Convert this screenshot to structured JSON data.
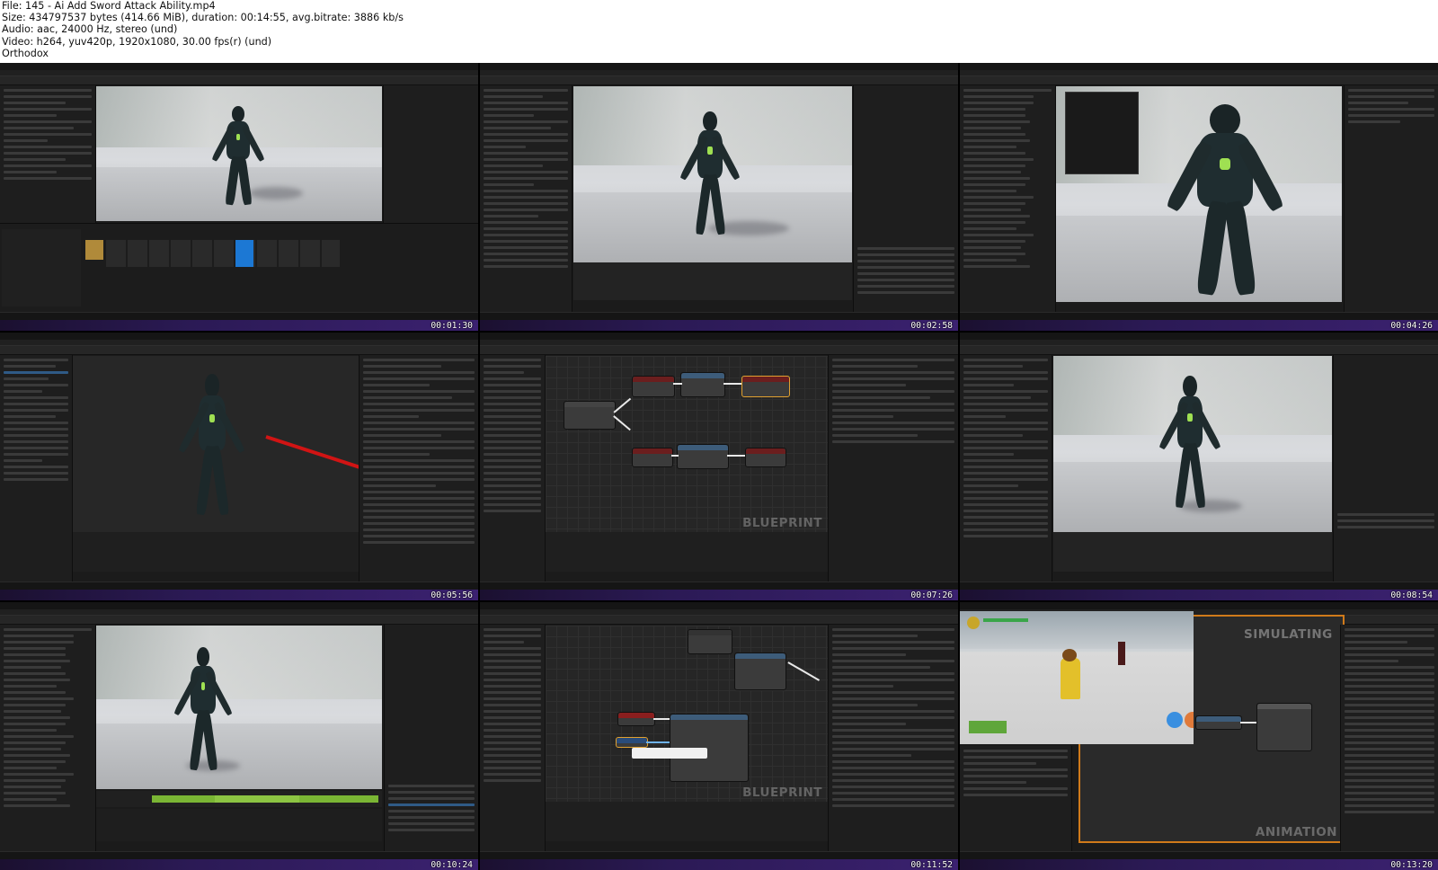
{
  "header": {
    "file": "File: 145 - Ai Add Sword Attack Ability.mp4",
    "size": "Size: 434797537 bytes (414.66 MiB), duration: 00:14:55, avg.bitrate: 3886 kb/s",
    "audio": "Audio: aac, 24000 Hz, stereo (und)",
    "video": "Video: h264, yuv420p, 1920x1080, 30.00 fps(r) (und)",
    "author": "Orthodox"
  },
  "thumbnails": [
    {
      "timestamp": "00:01:30",
      "kind": "animation-editor"
    },
    {
      "timestamp": "00:02:58",
      "kind": "animation-editor"
    },
    {
      "timestamp": "00:04:26",
      "kind": "skeleton-editor"
    },
    {
      "timestamp": "00:05:56",
      "kind": "blueprint-viewport"
    },
    {
      "timestamp": "00:07:26",
      "kind": "blueprint-graph",
      "watermark": "BLUEPRINT"
    },
    {
      "timestamp": "00:08:54",
      "kind": "animation-editor"
    },
    {
      "timestamp": "00:10:24",
      "kind": "montage-editor"
    },
    {
      "timestamp": "00:11:52",
      "kind": "blueprint-graph",
      "watermark": "BLUEPRINT"
    },
    {
      "timestamp": "00:13:20",
      "kind": "simulation",
      "watermark": "SIMULATING",
      "watermark2": "ANIMATION"
    }
  ]
}
